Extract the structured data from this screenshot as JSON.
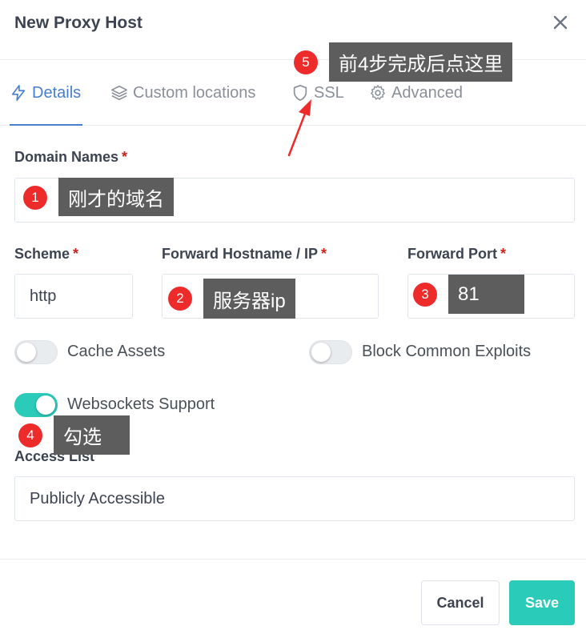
{
  "modal": {
    "title": "New Proxy Host"
  },
  "tabs": [
    {
      "label": "Details",
      "icon": "lightning-icon"
    },
    {
      "label": "Custom locations",
      "icon": "layers-icon"
    },
    {
      "label": "SSL",
      "icon": "shield-icon"
    },
    {
      "label": "Advanced",
      "icon": "gear-icon"
    }
  ],
  "form": {
    "domain_names": {
      "label": "Domain Names",
      "required": "*",
      "value": ""
    },
    "scheme": {
      "label": "Scheme",
      "required": "*",
      "value": "http"
    },
    "forward_hostname": {
      "label": "Forward Hostname / IP",
      "required": "*",
      "value": ""
    },
    "forward_port": {
      "label": "Forward Port",
      "required": "*",
      "value": ""
    },
    "toggles": {
      "cache_assets": {
        "label": "Cache Assets",
        "on": false
      },
      "block_common_exploits": {
        "label": "Block Common Exploits",
        "on": false
      },
      "websockets_support": {
        "label": "Websockets Support",
        "on": true
      }
    },
    "access_list": {
      "label": "Access List",
      "value": "Publicly Accessible"
    }
  },
  "footer": {
    "cancel_label": "Cancel",
    "save_label": "Save"
  },
  "annotations": [
    {
      "number": "1",
      "text": "刚才的域名"
    },
    {
      "number": "2",
      "text": "服务器ip"
    },
    {
      "number": "3",
      "text": "81"
    },
    {
      "number": "4",
      "text": "勾选"
    },
    {
      "number": "5",
      "text": "前4步完成后点这里"
    }
  ],
  "colors": {
    "accent": "#467fcf",
    "teal": "#2bcbba",
    "required": "#cd201f",
    "annotation_badge": "#ee2b2b",
    "annotation_box": "#5d5d5d"
  }
}
